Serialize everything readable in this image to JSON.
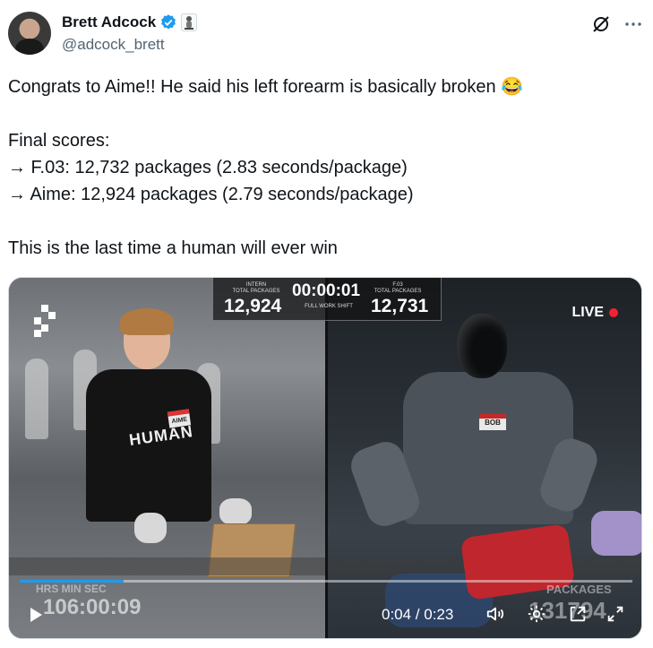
{
  "author": {
    "display_name": "Brett Adcock",
    "handle": "@adcock_brett"
  },
  "icons": {
    "verified": "verified-badge-icon",
    "affiliation": "affiliation-badge-icon",
    "grok": "grok-icon",
    "more": "more-icon"
  },
  "tweet": {
    "lines": [
      "Congrats to Aime!! He said his left forearm is basically broken 😂",
      "",
      "Final scores:",
      "→ F.03: 12,732 packages (2.83 seconds/package)",
      "→ Aime: 12,924 packages (2.79 seconds/package)",
      "",
      "This is the last time a human will ever win"
    ]
  },
  "video": {
    "scoreboard": {
      "left_label": "INTERN\nTOTAL PACKAGES",
      "left_value": "12,924",
      "timer": "00:00:01",
      "timer_label": "FULL WORK SHIFT",
      "right_label": "F.03\nTOTAL PACKAGES",
      "right_value": "12,731"
    },
    "live_label": "LIVE",
    "human_shirt_text": "HUMAN",
    "human_tag_text": "AIME",
    "robot_tag_text": "BOB",
    "overlay_left_label": "HRS MIN SEC",
    "overlay_left_value": "106:00:09",
    "overlay_right_label": "PACKAGES",
    "overlay_right_value": "131794",
    "time_display": "0:04 / 0:23",
    "progress": 0.17
  }
}
